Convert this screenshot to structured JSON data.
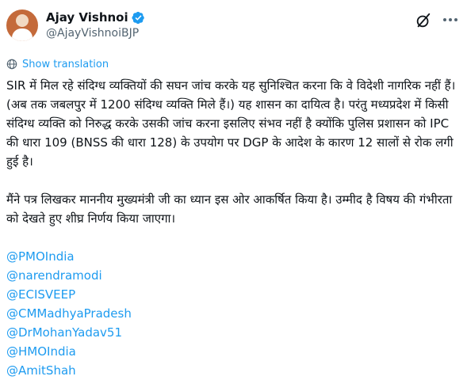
{
  "author": {
    "name": "Ajay Vishnoi",
    "handle": "@AjayVishnoiBJP",
    "verified_color": "#1d9bf0"
  },
  "icons": {
    "grok": "grok-icon",
    "more": "more-options-icon",
    "verified": "verified-badge-icon",
    "translate": "globe-icon"
  },
  "translate_label": "Show translation",
  "tweet": {
    "para1": "SIR में मिल रहे संदिग्ध व्यक्तियों की सघन जांच करके यह सुनिश्चित करना कि वे विदेशी नागरिक नहीं हैं। (अब तक जबलपुर में 1200 संदिग्ध व्यक्ति मिले हैं।) यह शासन का दायित्व है। परंतु मध्यप्रदेश में किसी संदिग्ध व्यक्ति को निरुद्ध करके उसकी जांच करना इसलिए संभव नहीं है क्योंकि पुलिस प्रशासन को IPC की धारा 109 (BNSS की धारा 128) के उपयोग पर DGP के आदेश के कारण 12 सालों से रोक लगी हुई है।",
    "para2": "मैंने पत्र लिखकर माननीय मुख्यमंत्री जी का ध्यान इस ओर आकर्षित किया है। उम्मीद है विषय की गंभीरता को देखते हुए शीघ्र निर्णय किया जाएगा।",
    "mentions": [
      "@PMOIndia",
      "@narendramodi",
      "@ECISVEEP",
      "@CMMadhyaPradesh",
      "@DrMohanYadav51",
      "@HMOIndia",
      "@AmitShah"
    ]
  },
  "colors": {
    "link": "#1d9bf0",
    "text": "#0f1419",
    "secondary": "#536471"
  }
}
